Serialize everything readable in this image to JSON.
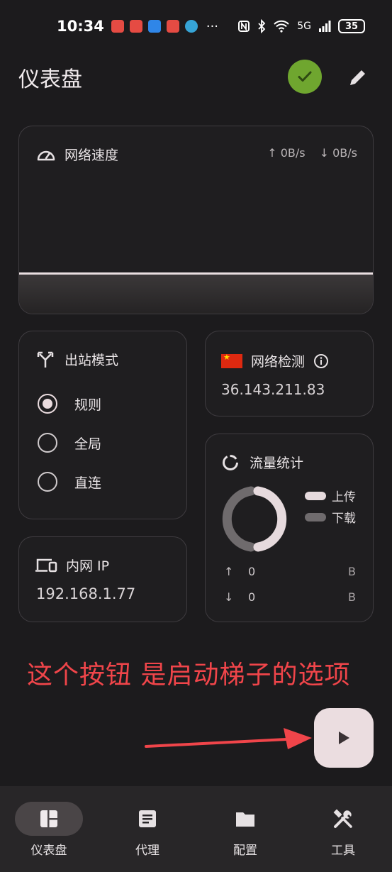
{
  "status_bar": {
    "time": "10:34",
    "more_indicator": "···",
    "network": "5G",
    "battery": "35"
  },
  "header": {
    "title": "仪表盘"
  },
  "speed_card": {
    "title": "网络速度",
    "upload": "↑ 0B/s",
    "download": "↓ 0B/s"
  },
  "outbound_card": {
    "title": "出站模式",
    "options": [
      {
        "label": "规则",
        "selected": true
      },
      {
        "label": "全局",
        "selected": false
      },
      {
        "label": "直连",
        "selected": false
      }
    ]
  },
  "network_check_card": {
    "title": "网络检测",
    "ip": "36.143.211.83",
    "flag_icon": "china-flag-icon"
  },
  "lan_ip_card": {
    "title": "内网 IP",
    "ip": "192.168.1.77"
  },
  "traffic_card": {
    "title": "流量统计",
    "legend": [
      {
        "label": "上传",
        "color": "#e6dadd"
      },
      {
        "label": "下载",
        "color": "#6f6b6d"
      }
    ],
    "upload_arrow": "↑",
    "upload_value": "0",
    "upload_unit": "B",
    "download_arrow": "↓",
    "download_value": "0",
    "download_unit": "B"
  },
  "annotation": {
    "text": "这个按钮 是启动梯子的选项",
    "color": "#f0454a"
  },
  "nav": {
    "items": [
      {
        "label": "仪表盘",
        "icon": "dashboard-icon",
        "active": true
      },
      {
        "label": "代理",
        "icon": "proxy-list-icon",
        "active": false
      },
      {
        "label": "配置",
        "icon": "folder-icon",
        "active": false
      },
      {
        "label": "工具",
        "icon": "tools-icon",
        "active": false
      }
    ]
  },
  "colors": {
    "accent": "#ebdde0",
    "status_ok": "#6fa62f",
    "background": "#1c1b1d"
  }
}
